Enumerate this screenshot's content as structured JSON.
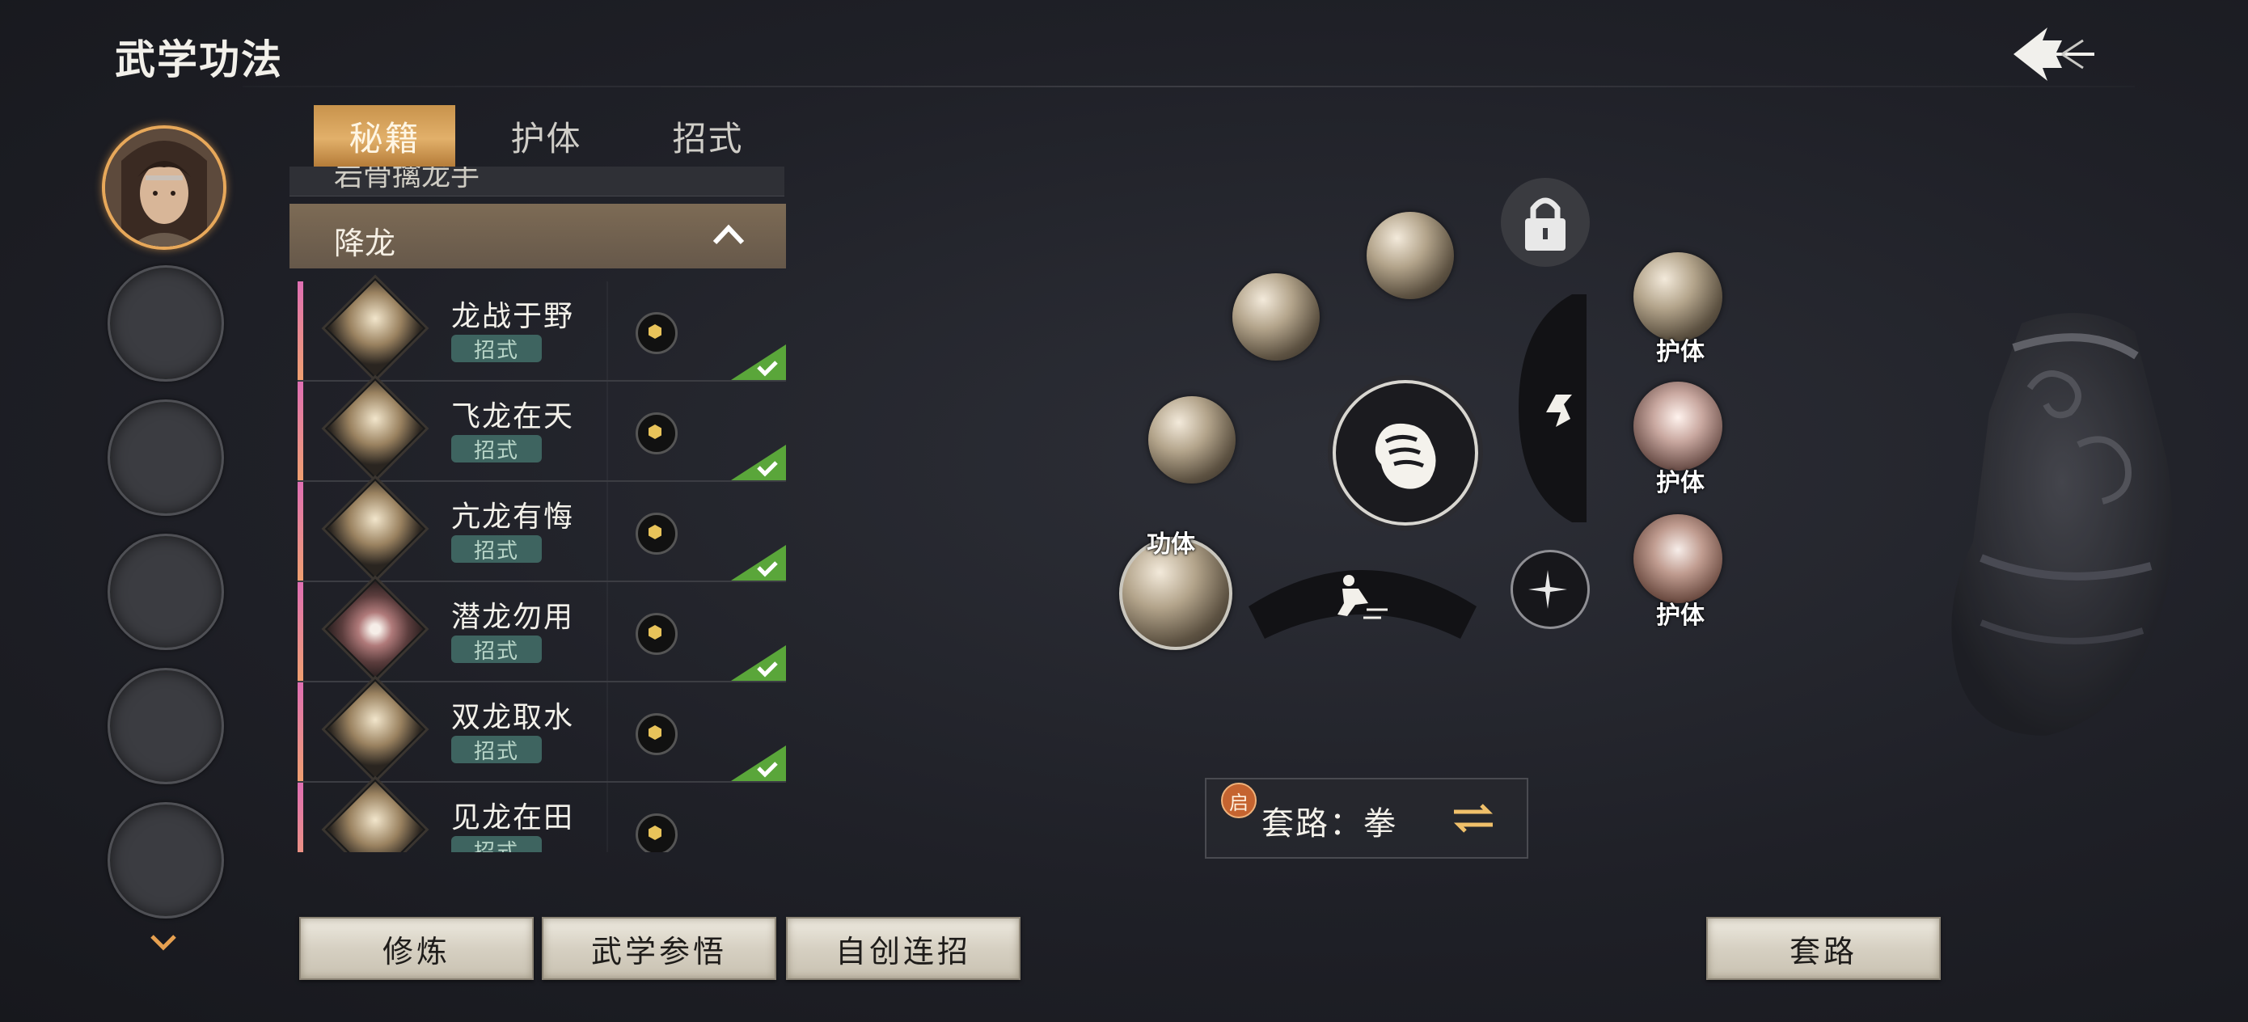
{
  "header": {
    "title": "武学功法"
  },
  "tabs": [
    {
      "label": "秘籍",
      "active": true
    },
    {
      "label": "护体",
      "active": false
    },
    {
      "label": "招式",
      "active": false
    }
  ],
  "list": {
    "prev_section_label": "岩骨擒龙手",
    "section_title": "降龙",
    "rows": [
      {
        "name": "龙战于野",
        "tag": "招式",
        "checked": true
      },
      {
        "name": "飞龙在天",
        "tag": "招式",
        "checked": true
      },
      {
        "name": "亢龙有悔",
        "tag": "招式",
        "checked": true
      },
      {
        "name": "潜龙勿用",
        "tag": "招式",
        "checked": true
      },
      {
        "name": "双龙取水",
        "tag": "招式",
        "checked": true
      },
      {
        "name": "见龙在田",
        "tag": "招式",
        "checked": false
      }
    ]
  },
  "wheel": {
    "gongti_label": "功体",
    "huti_labels": [
      "护体",
      "护体",
      "护体"
    ]
  },
  "taolu": {
    "badge": "启",
    "text": "套路：拳"
  },
  "buttons": {
    "xiulian": "修炼",
    "canwu": "武学参悟",
    "lianzhao": "自创连招",
    "taolu": "套路"
  },
  "colors": {
    "accent_gold": "#e2b06a",
    "check_green": "#5aa63a",
    "tag_teal": "#3e6460",
    "row_bar_pink": "#e06fb4"
  }
}
